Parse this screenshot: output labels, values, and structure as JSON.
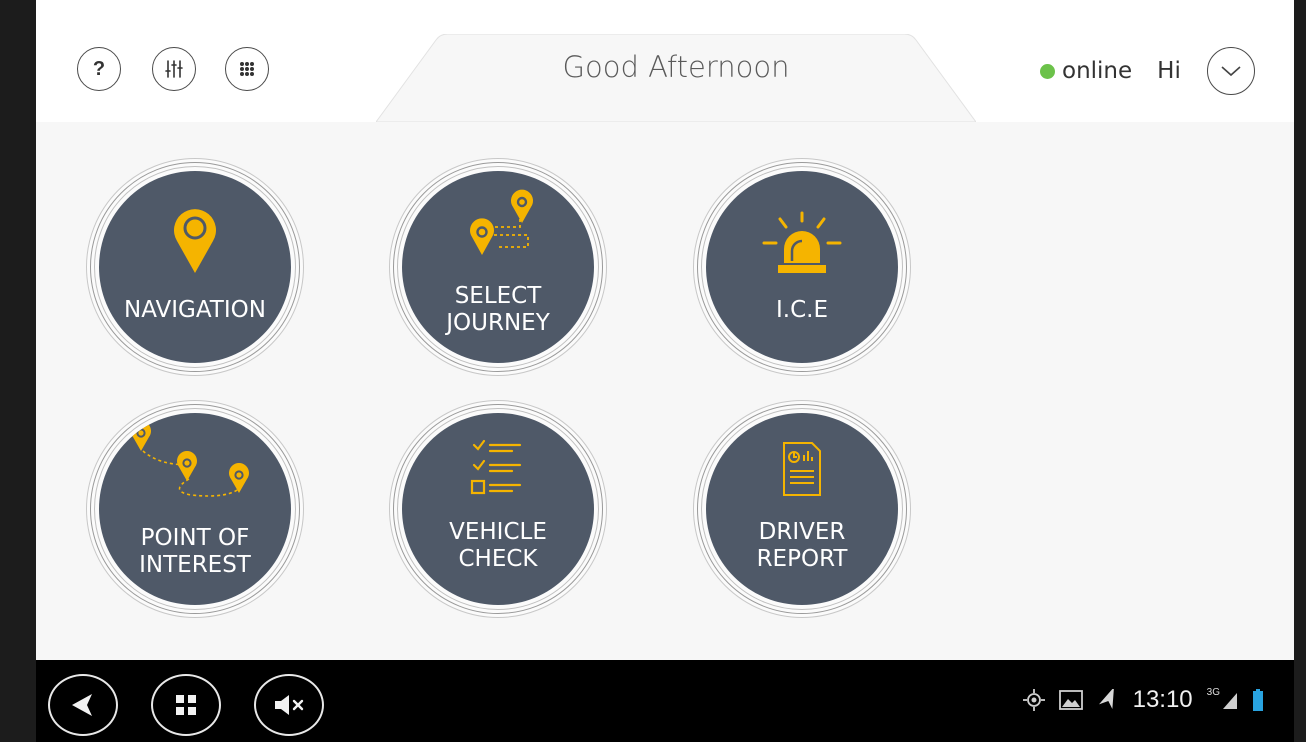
{
  "header": {
    "greeting": "Good Afternoon",
    "status": "online",
    "status_color": "#6cc24a",
    "user_greeting": "Hi",
    "left_icons": [
      "help-icon",
      "equalizer-icon",
      "apps-grid-icon"
    ],
    "right_icon": "chevron-down-icon"
  },
  "tiles": [
    {
      "label_lines": [
        "NAVIGATION"
      ],
      "icon": "map-pin-icon"
    },
    {
      "label_lines": [
        "SELECT",
        "JOURNEY"
      ],
      "icon": "route-icon"
    },
    {
      "label_lines": [
        "I.C.E"
      ],
      "icon": "emergency-beacon-icon"
    },
    {
      "label_lines": [
        "POINT OF",
        "INTEREST"
      ],
      "icon": "multi-pin-route-icon"
    },
    {
      "label_lines": [
        "VEHICLE",
        "CHECK"
      ],
      "icon": "checklist-icon"
    },
    {
      "label_lines": [
        "DRIVER",
        "REPORT"
      ],
      "icon": "report-document-icon"
    }
  ],
  "colors": {
    "accent": "#f5b400",
    "tile_fill": "#4f5968",
    "navbar": "#000000"
  },
  "system_bar": {
    "buttons": [
      "back-icon",
      "home-grid-icon",
      "mute-icon"
    ],
    "status_icons": [
      "gps-icon",
      "gallery-icon",
      "navigation-arrow-icon"
    ],
    "time": "13:10",
    "network": "3G"
  }
}
